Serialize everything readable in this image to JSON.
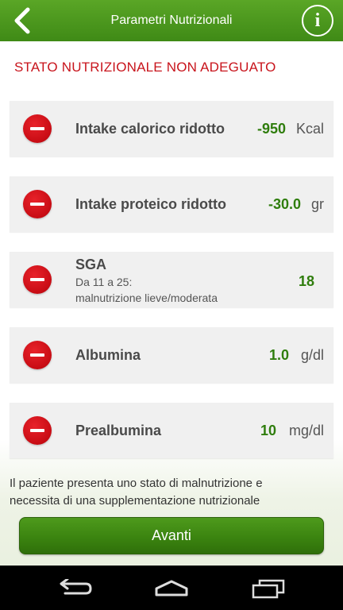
{
  "header": {
    "title": "Parametri Nutrizionali",
    "info_label": "i"
  },
  "status": {
    "text": "STATO NUTRIZIONALE NON ADEGUATO",
    "color": "#c8141c"
  },
  "parameters": [
    {
      "label": "Intake calorico ridotto",
      "value": "-950",
      "unit": "Kcal",
      "indicator": "minus-icon"
    },
    {
      "label": "Intake proteico ridotto",
      "value": "-30.0",
      "unit": "gr",
      "indicator": "minus-icon"
    },
    {
      "label": "SGA",
      "sub_line1": "Da 11 a 25:",
      "sub_line2": "malnutrizione lieve/moderata",
      "value": "18",
      "unit": "",
      "indicator": "minus-icon"
    },
    {
      "label": "Albumina",
      "value": "1.0",
      "unit": "g/dl",
      "indicator": "minus-icon"
    },
    {
      "label": "Prealbumina",
      "value": "10",
      "unit": "mg/dl",
      "indicator": "minus-icon"
    }
  ],
  "note": {
    "line1": "Il paziente presenta uno stato di malnutrizione e",
    "line2": "necessita di una supplementazione nutrizionale"
  },
  "actions": {
    "next_label": "Avanti"
  },
  "colors": {
    "brand_green": "#4a9620",
    "value_green": "#2f7d0d",
    "alert_red": "#c80c14"
  },
  "system_nav": {
    "back": "back-icon",
    "home": "home-icon",
    "recents": "recents-icon"
  }
}
